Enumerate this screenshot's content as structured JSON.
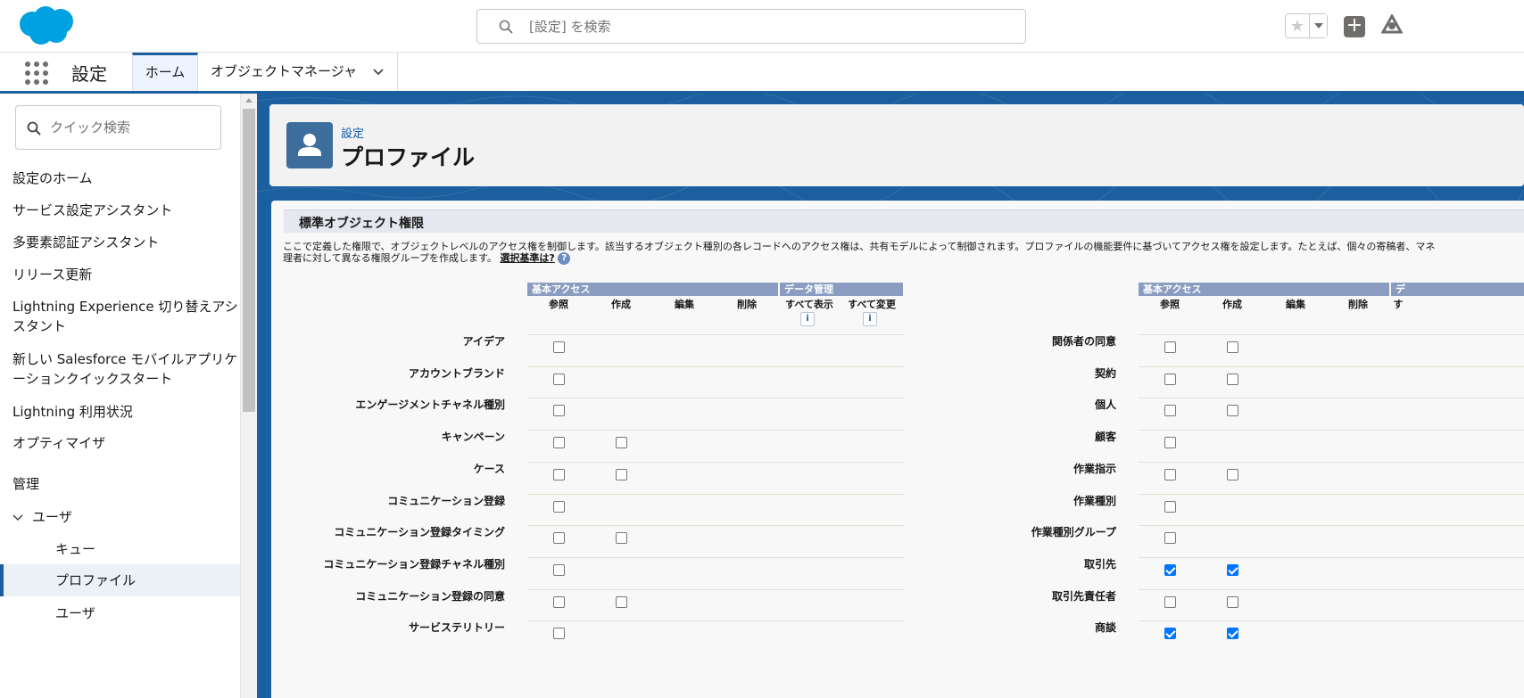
{
  "header": {
    "search_placeholder": "[設定] を検索"
  },
  "nav": {
    "app_name": "設定",
    "tabs": [
      {
        "label": "ホーム"
      },
      {
        "label": "オブジェクトマネージャ"
      }
    ]
  },
  "sidebar": {
    "quick_search_placeholder": "クイック検索",
    "items": [
      {
        "label": "設定のホーム"
      },
      {
        "label": "サービス設定アシスタント"
      },
      {
        "label": "多要素認証アシスタント"
      },
      {
        "label": "リリース更新"
      },
      {
        "label": "Lightning Experience 切り替えアシスタント"
      },
      {
        "label": "新しい Salesforce モバイルアプリケーションクイックスタート"
      },
      {
        "label": "Lightning 利用状況"
      },
      {
        "label": "オプティマイザ"
      }
    ],
    "section_label": "管理",
    "group_label": "ユーザ",
    "sub_items": [
      {
        "label": "キュー"
      },
      {
        "label": "プロファイル"
      },
      {
        "label": "ユーザ"
      }
    ]
  },
  "page": {
    "breadcrumb": "設定",
    "title": "プロファイル"
  },
  "panel": {
    "section_title": "標準オブジェクト権限",
    "description_line1": "ここで定義した権限で、オブジェクトレベルのアクセス権を制御します。該当するオブジェクト種別の各レコードへのアクセス権は、共有モデルによって制御されます。プロファイルの機能要件に基づいてアクセス権を設定します。たとえば、個々の寄稿者、マネ",
    "description_line2": "理者に対して異なる権限グループを作成します。",
    "criteria_link": "選択基準は?",
    "help_glyph": "?",
    "info_glyph": "i",
    "group_basic": "基本アクセス",
    "group_data": "データ管理",
    "group_data_right": "デ",
    "columns": [
      "参照",
      "作成",
      "編集",
      "削除",
      "すべて表示",
      "すべて変更"
    ],
    "columns_right_partial": "す",
    "left_rows": [
      {
        "name": "アイデア",
        "read": false,
        "create": null
      },
      {
        "name": "アカウントブランド",
        "read": false,
        "create": null
      },
      {
        "name": "エンゲージメントチャネル種別",
        "read": false,
        "create": null
      },
      {
        "name": "キャンペーン",
        "read": false,
        "create": false
      },
      {
        "name": "ケース",
        "read": false,
        "create": false
      },
      {
        "name": "コミュニケーション登録",
        "read": false,
        "create": null
      },
      {
        "name": "コミュニケーション登録タイミング",
        "read": false,
        "create": false
      },
      {
        "name": "コミュニケーション登録チャネル種別",
        "read": false,
        "create": null
      },
      {
        "name": "コミュニケーション登録の同意",
        "read": false,
        "create": false
      },
      {
        "name": "サービステリトリー",
        "read": false,
        "create": null
      }
    ],
    "right_rows": [
      {
        "name": "関係者の同意",
        "read": false,
        "create": false
      },
      {
        "name": "契約",
        "read": false,
        "create": false
      },
      {
        "name": "個人",
        "read": false,
        "create": false
      },
      {
        "name": "顧客",
        "read": false,
        "create": null
      },
      {
        "name": "作業指示",
        "read": false,
        "create": false
      },
      {
        "name": "作業種別",
        "read": false,
        "create": null
      },
      {
        "name": "作業種別グループ",
        "read": false,
        "create": null
      },
      {
        "name": "取引先",
        "read": true,
        "create": true
      },
      {
        "name": "取引先責任者",
        "read": false,
        "create": false
      },
      {
        "name": "商談",
        "read": true,
        "create": true
      }
    ]
  },
  "colors": {
    "brand_blue": "#1b5f9e",
    "group_header": "#8a9dc0",
    "checkbox_on": "#0075ff"
  }
}
